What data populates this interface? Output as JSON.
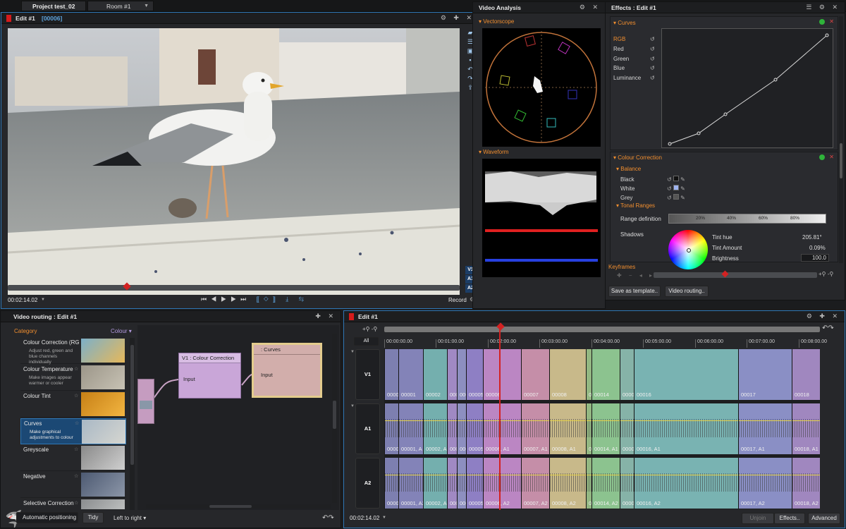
{
  "tabs": {
    "project": "Project test_02",
    "room": "Room #1"
  },
  "viewer": {
    "title": "Edit #1",
    "frame": "[00006]",
    "timecode": "00:02:14.02",
    "record": "Record",
    "side_tracks": [
      "V1",
      "A1",
      "A2"
    ]
  },
  "analysis": {
    "title": "Video Analysis",
    "vectorscope": "Vectorscope",
    "waveform": "Waveform"
  },
  "effects": {
    "title": "Effects : Edit #1",
    "curves": "Curves",
    "channels": [
      "RGB",
      "Red",
      "Green",
      "Blue",
      "Luminance"
    ],
    "colour_correction": "Colour Correction",
    "balance": "Balance",
    "balance_rows": [
      "Black",
      "White",
      "Grey"
    ],
    "tonal_ranges": "Tonal Ranges",
    "range_definition": "Range definition",
    "range_ticks": [
      "20%",
      "40%",
      "60%",
      "80%"
    ],
    "shadows": "Shadows",
    "tint_hue_label": "Tint hue",
    "tint_hue_value": "205.81°",
    "tint_amount_label": "Tint Amount",
    "tint_amount_value": "0.09%",
    "brightness_label": "Brightness",
    "brightness_value": "100.0",
    "keyframes": "Keyframes",
    "save_template": "Save as template..",
    "video_routing": "Video routing.."
  },
  "routing": {
    "title": "Video routing : Edit #1",
    "category_label": "Category",
    "colour_label": "Colour",
    "categories": [
      {
        "name": "Colour Correction (RG",
        "desc": "Adjust red, green and blue channels individually"
      },
      {
        "name": "Colour Temperature",
        "desc": "Make images appear warmer or cooler"
      },
      {
        "name": "Colour Tint",
        "desc": ""
      },
      {
        "name": "Curves",
        "desc": "Make graphical adjustments to colour"
      },
      {
        "name": "Greyscale",
        "desc": ""
      },
      {
        "name": "Negative",
        "desc": ""
      },
      {
        "name": "Selective Correction",
        "desc": ""
      }
    ],
    "node1_title": "V1 : Colour Correction",
    "node1_port": "Input",
    "node2_title": ": Curves",
    "node2_port": "Input",
    "auto_positioning": "Automatic positioning",
    "tidy": "Tidy",
    "left_to_right": "Left to right"
  },
  "timeline": {
    "title": "Edit #1",
    "all": "All",
    "timecode": "00:02:14.02",
    "ticks": [
      "00:00:00.00",
      "00:01:00.00",
      "00:02:00.00",
      "00:03:00.00",
      "00:04:00.00",
      "00:05:00.00",
      "00:06:00.00",
      "00:07:00.00",
      "00:08:00.00"
    ],
    "tracks": [
      "V1",
      "A1",
      "A2"
    ],
    "clips": [
      {
        "v": "0000",
        "a": "0000",
        "color": "#7d7fb0"
      },
      {
        "v": "00001",
        "a": "00001, A",
        "color": "#8383b8"
      },
      {
        "v": "00002",
        "a": "00002, A",
        "color": "#74afae"
      },
      {
        "v": "0000",
        "a": "0000",
        "color": "#a089c3"
      },
      {
        "v": "0000",
        "a": "0000",
        "color": "#8d8fc0"
      },
      {
        "v": "00005",
        "a": "00005",
        "color": "#8e7fc4"
      },
      {
        "v": "00006",
        "a": "00006, A1",
        "color": "#bb86c3"
      },
      {
        "v": "00007",
        "a": "00007, A1",
        "color": "#c58ea8"
      },
      {
        "v": "00008",
        "a": "00008, A1",
        "color": "#c8b98a"
      },
      {
        "v": "0000",
        "a": "0000",
        "color": "#93b882"
      },
      {
        "v": "00014",
        "a": "00014, A1",
        "color": "#8cc38f"
      },
      {
        "v": "0000",
        "a": "0000",
        "color": "#86b3a8"
      },
      {
        "v": "00016",
        "a": "00016, A1",
        "color": "#79b3b2"
      },
      {
        "v": "00017",
        "a": "00017, A1",
        "color": "#8a8fc5"
      },
      {
        "v": "00018",
        "a": "00018, A1",
        "color": "#a087bf"
      }
    ],
    "unjoin": "Unjoin",
    "effects": "Effects..",
    "advanced": "Advanced"
  }
}
